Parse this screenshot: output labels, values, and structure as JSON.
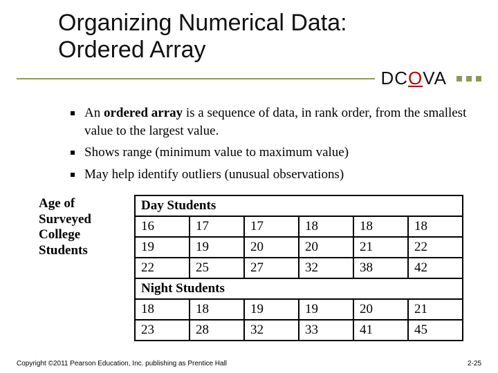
{
  "title_line1": "Organizing Numerical Data:",
  "title_line2": "Ordered Array",
  "dcova": {
    "d": "D",
    "c": "C",
    "o": "O",
    "v": "V",
    "a": "A"
  },
  "bullets": [
    {
      "pre": "An ",
      "bold": "ordered array",
      "post": " is a sequence of data, in rank order, from the smallest value to the largest value."
    },
    {
      "pre": "",
      "bold": "",
      "post": "Shows range (minimum value to maximum value)"
    },
    {
      "pre": "",
      "bold": "",
      "post": "May help identify outliers (unusual observations)"
    }
  ],
  "side_label": "Age of Surveyed College Students",
  "table": {
    "header_day": "Day Students",
    "rows_day": [
      [
        "16",
        "17",
        "17",
        "18",
        "18",
        "18"
      ],
      [
        "19",
        "19",
        "20",
        "20",
        "21",
        "22"
      ],
      [
        "22",
        "25",
        "27",
        "32",
        "38",
        "42"
      ]
    ],
    "header_night": "Night Students",
    "rows_night": [
      [
        "18",
        "18",
        "19",
        "19",
        "20",
        "21"
      ],
      [
        "23",
        "28",
        "32",
        "33",
        "41",
        "45"
      ]
    ]
  },
  "footer_left": "Copyright ©2011 Pearson Education, Inc. publishing as Prentice Hall",
  "footer_right": "2-25",
  "chart_data": {
    "type": "table",
    "title": "Age of Surveyed College Students",
    "series": [
      {
        "name": "Day Students",
        "values": [
          16,
          17,
          17,
          18,
          18,
          18,
          19,
          19,
          20,
          20,
          21,
          22,
          22,
          25,
          27,
          32,
          38,
          42
        ]
      },
      {
        "name": "Night Students",
        "values": [
          18,
          18,
          19,
          19,
          20,
          21,
          23,
          28,
          32,
          33,
          41,
          45
        ]
      }
    ]
  }
}
